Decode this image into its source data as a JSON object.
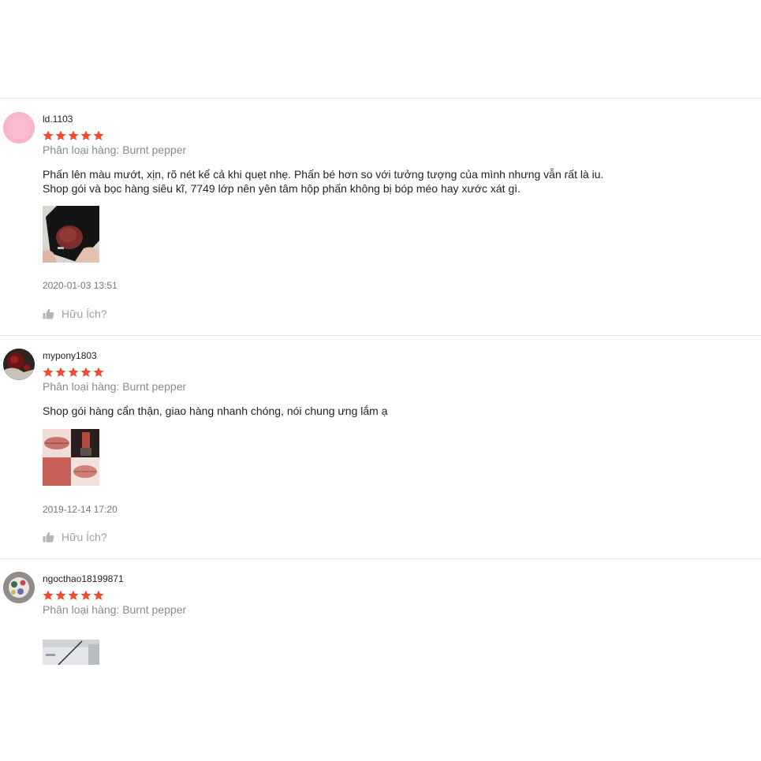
{
  "reviews": [
    {
      "username": "ld.1103",
      "rating": 5,
      "variation": "Phân loại hàng: Burnt pepper",
      "comment_lines": [
        "Phấn lên màu mướt, xịn, rõ nét kể cả khi quẹt nhẹ. Phấn bé hơn so với tưởng tượng của mình nhưng vẫn rất là iu.",
        "Shop gói và bọc hàng siêu kĩ, 7749 lớp nên yên tâm hộp phấn không bị bóp méo hay xước xát gì."
      ],
      "date": "2020-01-03 13:51",
      "helpful_label": "Hữu Ích?"
    },
    {
      "username": "mypony1803",
      "rating": 5,
      "variation": "Phân loại hàng: Burnt pepper",
      "comment_lines": [
        "Shop gói hàng cẩn thận, giao hàng nhanh chóng, nói chung ưng lắm ạ"
      ],
      "date": "2019-12-14 17:20",
      "helpful_label": "Hữu Ích?"
    },
    {
      "username": "ngocthao18199871",
      "rating": 5,
      "variation": "Phân loại hàng: Burnt pepper"
    }
  ],
  "colors": {
    "star": "#ee4d2d",
    "muted_text": "#8a8a8a",
    "helpful_text": "#a0a0a0"
  },
  "icons": {
    "star": "star-icon",
    "helpful": "thumbs-up-icon"
  }
}
